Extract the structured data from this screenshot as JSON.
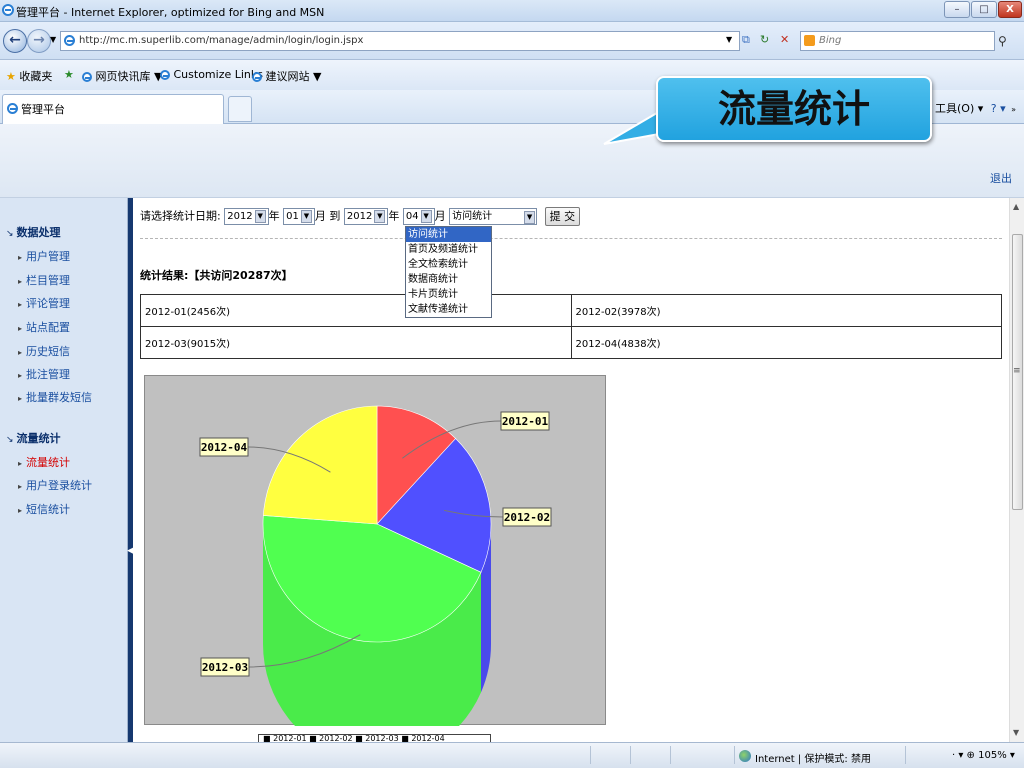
{
  "window": {
    "title": "管理平台 - Internet Explorer, optimized for Bing and MSN",
    "min": "–",
    "max": "□",
    "close": "X"
  },
  "navbar": {
    "back": "←",
    "forward": "→",
    "url": "http://mc.m.superlib.com/manage/admin/login/login.jspx",
    "search_placeholder": "Bing",
    "search_icon": "search-icon"
  },
  "favorites": {
    "favorites_label": "收藏夹",
    "items": [
      "网页快讯库 ▼",
      "Customize Links",
      "建议网站 ▼"
    ]
  },
  "tab": {
    "title": "管理平台",
    "tools": "工具(O) ▾",
    "help": "? ▾"
  },
  "callout": {
    "text": "流量统计"
  },
  "banner": {
    "logout": "退出"
  },
  "sidebar": {
    "sections": [
      {
        "title": "数据处理",
        "items": [
          "用户管理",
          "栏目管理",
          "评论管理",
          "站点配置",
          "历史短信",
          "批注管理",
          "批量群发短信"
        ]
      },
      {
        "title": "流量统计",
        "items": [
          "流量统计",
          "用户登录统计",
          "短信统计"
        ]
      }
    ]
  },
  "form": {
    "label": "请选择统计日期:",
    "start_year": "2012",
    "year_label": "年",
    "start_month": "01",
    "month_label": "月",
    "to_label": "到",
    "end_year": "2012",
    "end_year_label": "年",
    "end_month": "04",
    "end_month_label": "月",
    "stat_type": "访问统计",
    "submit": "提 交",
    "options": [
      "访问统计",
      "首页及频道统计",
      "全文检索统计",
      "数据商统计",
      "卡片页统计",
      "文献传递统计"
    ]
  },
  "result": {
    "summary": "统计结果:【共访问20287次】",
    "rows": [
      [
        "2012-01(2456次)",
        "2012-02(3978次)"
      ],
      [
        "2012-03(9015次)",
        "2012-04(4838次)"
      ]
    ]
  },
  "chart_data": {
    "type": "pie",
    "categories": [
      "2012-01",
      "2012-02",
      "2012-03",
      "2012-04"
    ],
    "values": [
      2456,
      3978,
      9015,
      4838
    ],
    "colors": [
      "#ff5050",
      "#5050ff",
      "#50ff50",
      "#ffff40"
    ],
    "legend": "■ 2012-01  ■ 2012-02  ■ 2012-03  ■ 2012-04"
  },
  "statusbar": {
    "zone": "Internet | 保护模式: 禁用",
    "zoom": "· ▾  ⊕ 105%  ▾"
  }
}
